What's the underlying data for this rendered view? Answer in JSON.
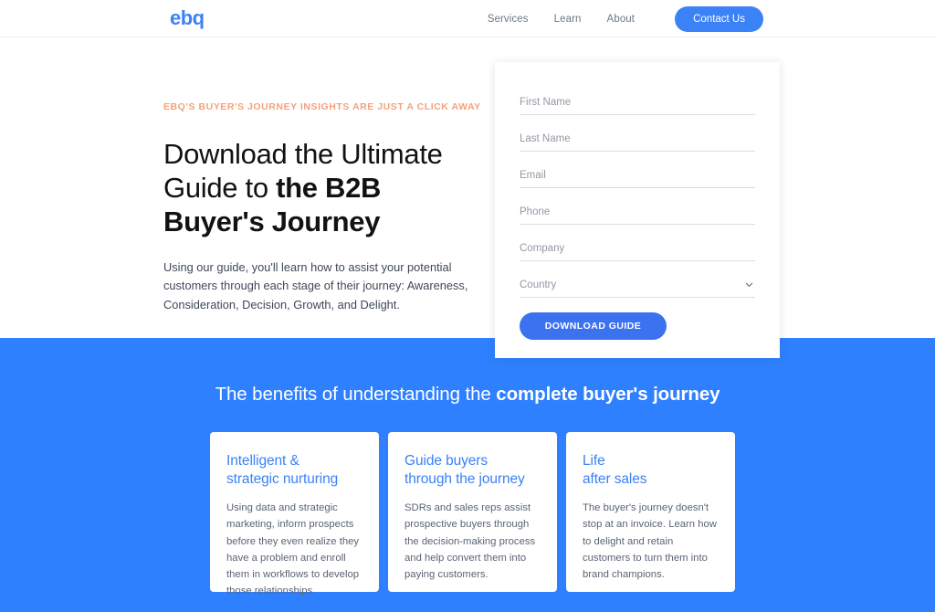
{
  "header": {
    "logo_text": "ebq",
    "nav": [
      {
        "label": "Services"
      },
      {
        "label": "Learn"
      },
      {
        "label": "About"
      }
    ],
    "contact_label": "Contact Us"
  },
  "hero": {
    "eyebrow": "EBQ'S BUYER'S JOURNEY INSIGHTS ARE JUST A CLICK AWAY",
    "headline_regular": "Download the Ultimate Guide to ",
    "headline_bold": "the B2B Buyer's Journey",
    "subtext": "Using our guide, you'll learn how to assist your potential customers through each stage of their journey: Awareness, Consideration, Decision, Growth, and Delight."
  },
  "form": {
    "fields": [
      {
        "name": "first-name",
        "placeholder": "First Name",
        "value": "",
        "type": "text"
      },
      {
        "name": "last-name",
        "placeholder": "Last Name",
        "value": "",
        "type": "text"
      },
      {
        "name": "email",
        "placeholder": "Email",
        "value": "",
        "type": "text"
      },
      {
        "name": "phone",
        "placeholder": "Phone",
        "value": "",
        "type": "text"
      },
      {
        "name": "company",
        "placeholder": "Company",
        "value": "",
        "type": "text"
      }
    ],
    "country": {
      "label": "Country",
      "selected": "Country",
      "icon": "chevron-down-icon"
    },
    "submit_label": "DOWNLOAD GUIDE"
  },
  "benefits": {
    "title_regular": "The benefits of understanding the ",
    "title_bold": "complete buyer's journey",
    "cards": [
      {
        "title_line1": "Intelligent &",
        "title_line2": "strategic nurturing",
        "body": "Using data and strategic marketing, inform prospects before they even realize they have a problem and enroll them in workflows to develop those relationships."
      },
      {
        "title_line1": "Guide buyers",
        "title_line2": "through the journey",
        "body": "SDRs and sales reps assist prospective buyers through the decision-making process and help convert them into paying customers."
      },
      {
        "title_line1": "Life",
        "title_line2": "after sales",
        "body": "The buyer's journey doesn't stop at an invoice. Learn how to delight and retain customers to turn them into brand champions."
      }
    ]
  },
  "colors": {
    "brand_blue": "#3b82f6",
    "section_blue": "#2f80ff",
    "eyebrow_salmon": "#f3a27a",
    "button_blue": "#3b72f0"
  }
}
